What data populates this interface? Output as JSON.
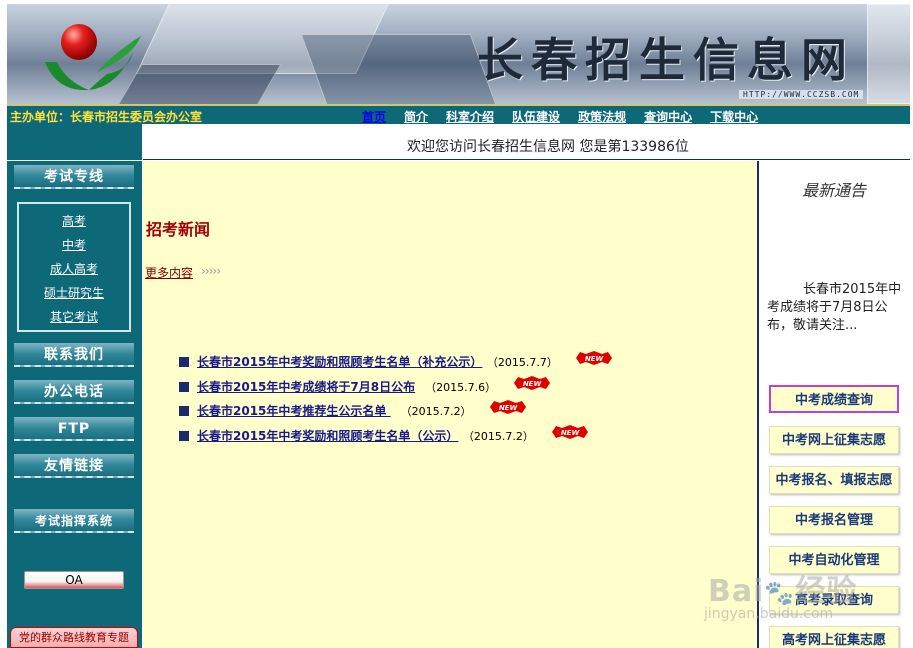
{
  "banner": {
    "title": "长春招生信息网",
    "url": "HTTP://WWW.CCZSB.COM"
  },
  "navbar": {
    "host_label": "主办单位：长春市招生委员会办公室",
    "items": [
      {
        "label": "首页",
        "active": true
      },
      {
        "label": "简介"
      },
      {
        "label": "科室介绍"
      },
      {
        "label": "队伍建设"
      },
      {
        "label": "政策法规"
      },
      {
        "label": "查询中心"
      },
      {
        "label": "下载中心"
      }
    ]
  },
  "welcome": {
    "text": "欢迎您访问长春招生信息网   您是第133986位"
  },
  "sidebar": {
    "exam_header": "考试专线",
    "exam_links": [
      "高考",
      "中考",
      "成人高考",
      "硕士研究生",
      "其它考试"
    ],
    "contact": "联系我们",
    "phone": "办公电话",
    "ftp": "FTP",
    "friend_links": "友情链接",
    "command_system": "考试指挥系统",
    "oa": "OA",
    "party_banner": "党的群众路线教育专题"
  },
  "main": {
    "heading": "招考新闻",
    "more_label": "更多内容",
    "more_arrows": "›››››",
    "news": [
      {
        "title": "长春市2015年中考奖励和照顾考生名单（补充公示）",
        "date": "（2015.7.7）",
        "badge": "NEW"
      },
      {
        "title": "长春市2015年中考成绩将于7月8日公布",
        "date": "（2015.7.6）",
        "badge": "NEW"
      },
      {
        "title": "长春市2015年中考推荐生公示名单 ",
        "date": "（2015.7.2）",
        "badge": "NEW"
      },
      {
        "title": "长春市2015年中考奖励和照顾考生名单（公示）",
        "date": "（2015.7.2）",
        "badge": "NEW"
      }
    ]
  },
  "right": {
    "notice_title": "最新通告",
    "notice_text": "长春市2015年中考成绩将于7月8日公布，敬请关注...",
    "buttons": [
      "中考成绩查询",
      "中考网上征集志愿",
      "中考报名、填报志愿",
      "中考报名管理",
      "中考自动化管理",
      "高考录取查询",
      "高考网上征集志愿"
    ]
  },
  "watermark": {
    "brand": "Bai",
    "brand_suffix": "经验",
    "sub": "jingyan.baidu.com"
  },
  "colors": {
    "nav_bg": "#0d6877",
    "main_bg": "#ffffcc",
    "news_title": "#1a1a8a",
    "heading": "#a40000",
    "highlight_border": "#c040d0"
  }
}
